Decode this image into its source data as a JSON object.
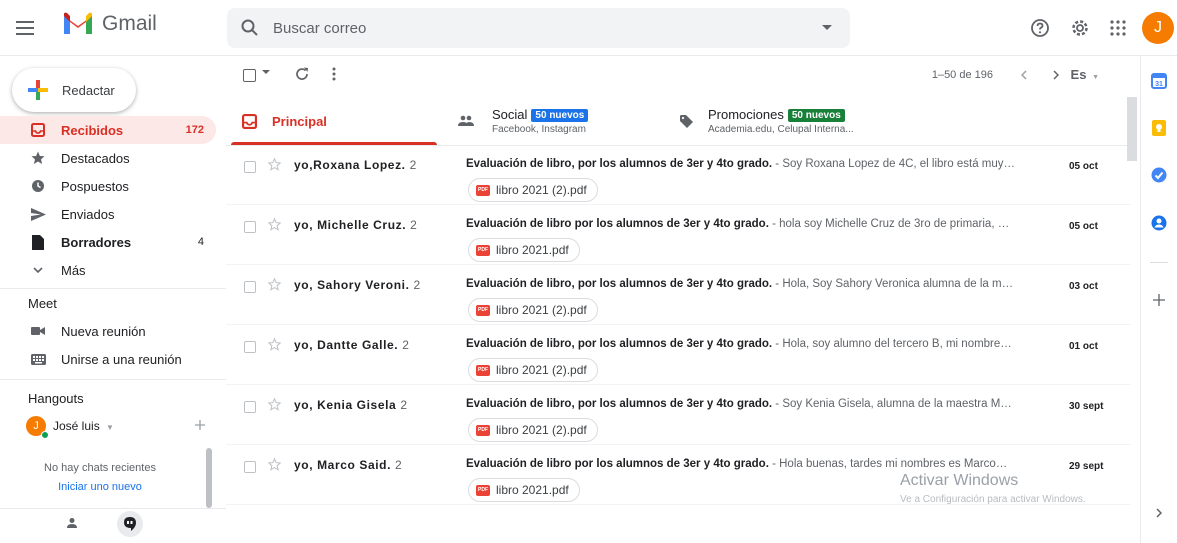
{
  "header": {
    "logo_text": "Gmail",
    "search_placeholder": "Buscar correo",
    "avatar_initial": "J"
  },
  "sidebar": {
    "compose_label": "Redactar",
    "items": [
      {
        "label": "Recibidos",
        "count": "172"
      },
      {
        "label": "Destacados",
        "count": ""
      },
      {
        "label": "Pospuestos",
        "count": ""
      },
      {
        "label": "Enviados",
        "count": ""
      },
      {
        "label": "Borradores",
        "count": "4"
      },
      {
        "label": "Más",
        "count": ""
      }
    ],
    "meet_title": "Meet",
    "meet_items": [
      "Nueva reunión",
      "Unirse a una reunión"
    ],
    "hangouts_title": "Hangouts",
    "hangouts_user": "José luis",
    "hangouts_avatar_initial": "J",
    "no_chats": "No hay chats recientes",
    "start_new": "Iniciar uno nuevo"
  },
  "toolbar": {
    "pagination": "1–50 de 196",
    "input_tool": "Es"
  },
  "tabs": [
    {
      "title": "Principal",
      "badge": "",
      "sub": ""
    },
    {
      "title": "Social",
      "badge": "50 nuevos",
      "sub": "Facebook, Instagram"
    },
    {
      "title": "Promociones",
      "badge": "50 nuevos",
      "sub": "Academia.edu, Celupal Interna..."
    }
  ],
  "emails": [
    {
      "sender": "yo,Roxana Lopez.",
      "count": "2",
      "subject": "Evaluación de libro, por los alumnos de 3er y 4to grado.",
      "snippet": " - Soy Roxana Lopez de 4C, el libro está muy…",
      "date": "05 oct",
      "attachment": "libro 2021 (2).pdf"
    },
    {
      "sender": "yo, Michelle Cruz.",
      "count": "2",
      "subject": "Evaluación de libro por los alumnos de 3er y 4to grado.",
      "snippet": " - hola soy Michelle Cruz de 3ro de primaria, …",
      "date": "05 oct",
      "attachment": "libro 2021.pdf"
    },
    {
      "sender": "yo, Sahory Veroni.",
      "count": "2",
      "subject": "Evaluación de libro, por los alumnos de 3er y 4to grado.",
      "snippet": " - Hola, Soy Sahory Veronica alumna de la m…",
      "date": "03 oct",
      "attachment": "libro 2021 (2).pdf"
    },
    {
      "sender": "yo, Dantte Galle.",
      "count": "2",
      "subject": "Evaluación de libro, por los alumnos de 3er y 4to grado.",
      "snippet": " - Hola, soy alumno del tercero B, mi nombre…",
      "date": "01 oct",
      "attachment": "libro 2021 (2).pdf"
    },
    {
      "sender": "yo, Kenia Gisela",
      "count": "2",
      "subject": "Evaluación de libro, por los alumnos de 3er y 4to grado.",
      "snippet": " - Soy Kenia Gisela, alumna de la maestra M…",
      "date": "30 sept",
      "attachment": "libro 2021 (2).pdf"
    },
    {
      "sender": "yo, Marco Said.",
      "count": "2",
      "subject": "Evaluación de libro por los alumnos de 3er y 4to grado.",
      "snippet": " - Hola buenas, tardes mi nombres es Marco…",
      "date": "29 sept",
      "attachment": "libro 2021.pdf"
    }
  ],
  "watermark": {
    "title": "Activar Windows",
    "subtitle": "Ve a Configuración para activar Windows."
  },
  "colors": {
    "accent_red": "#d93025",
    "social_badge": "#1a73e8",
    "promo_badge": "#188038"
  }
}
